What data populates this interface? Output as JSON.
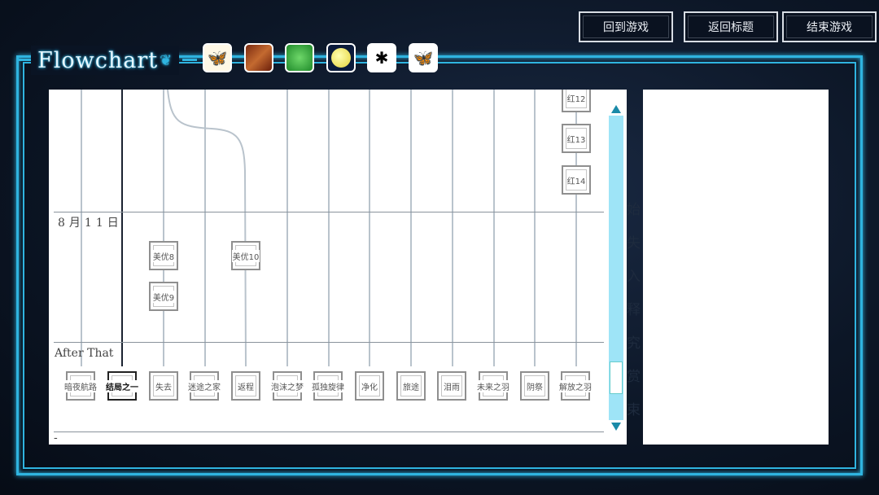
{
  "top_buttons": {
    "back_to_game": "回到游戏",
    "return_title": "返回标题",
    "end_game": "结束游戏"
  },
  "logo": "Flowchart",
  "route_icons": [
    "butterfly-icon",
    "pattern-icon",
    "leaf-icon",
    "moon-icon",
    "spider-icon",
    "blue-butterfly-icon"
  ],
  "dates": {
    "aug11": "8月11日",
    "after": "After That"
  },
  "nodes_top": [
    "红12",
    "红13",
    "红14"
  ],
  "nodes_aug11": [
    "美优8",
    "美优9",
    "美优10"
  ],
  "endings": [
    "暗夜航路",
    "结局之一",
    "失去",
    "迷途之家",
    "返程",
    "泡沫之梦",
    "孤独旋律",
    "净化",
    "旅途",
    "泪雨",
    "未来之羽",
    "阴祭",
    "解放之羽"
  ],
  "bottom_marker": "-",
  "bg_text": [
    "始",
    "失",
    "入",
    "释",
    "究",
    "赏",
    "束"
  ]
}
